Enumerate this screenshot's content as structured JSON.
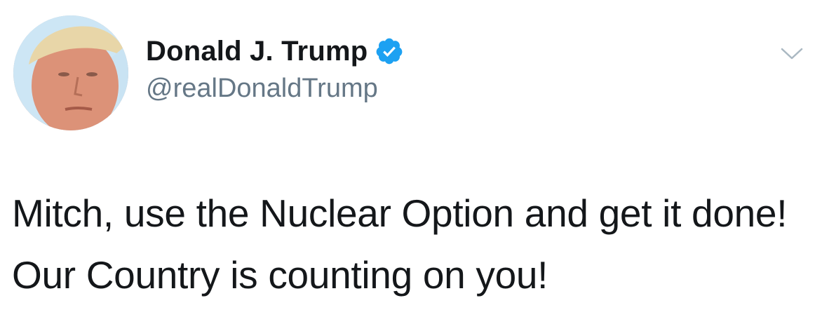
{
  "tweet": {
    "author": {
      "display_name": "Donald J. Trump",
      "handle": "@realDonaldTrump",
      "verified": true,
      "avatar_icon": "profile-photo"
    },
    "text": "Mitch, use the Nuclear Option and get it done! Our Country is counting on you!",
    "menu_icon": "chevron-down-icon"
  },
  "colors": {
    "text_primary": "#14171a",
    "text_secondary": "#657786",
    "verified_badge": "#1da1f2",
    "chevron": "#aab8c2",
    "background": "#ffffff"
  }
}
